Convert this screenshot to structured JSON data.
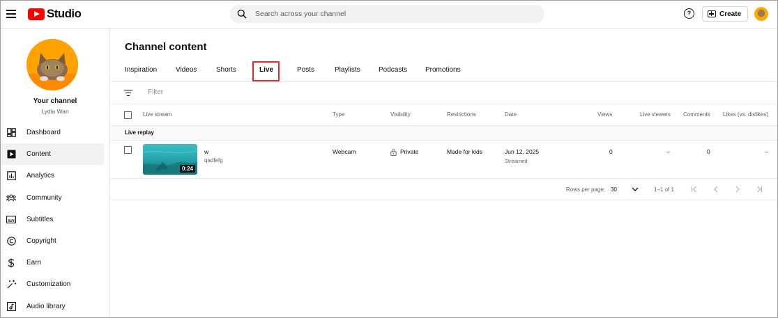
{
  "app": {
    "logo_text": "Studio"
  },
  "search": {
    "placeholder": "Search across your channel"
  },
  "header": {
    "create_label": "Create",
    "help_glyph": "?"
  },
  "sidebar": {
    "channel_name": "Your channel",
    "channel_user": "Lydia Wan",
    "items": [
      {
        "label": "Dashboard",
        "icon": "dashboard-icon"
      },
      {
        "label": "Content",
        "icon": "content-icon",
        "active": true
      },
      {
        "label": "Analytics",
        "icon": "analytics-icon"
      },
      {
        "label": "Community",
        "icon": "community-icon"
      },
      {
        "label": "Subtitles",
        "icon": "subtitles-icon"
      },
      {
        "label": "Copyright",
        "icon": "copyright-icon"
      },
      {
        "label": "Earn",
        "icon": "earn-icon"
      },
      {
        "label": "Customization",
        "icon": "customization-icon"
      },
      {
        "label": "Audio library",
        "icon": "audio-library-icon"
      }
    ]
  },
  "main": {
    "title": "Channel content",
    "tabs": [
      "Inspiration",
      "Videos",
      "Shorts",
      "Live",
      "Posts",
      "Playlists",
      "Podcasts",
      "Promotions"
    ],
    "active_tab": "Live",
    "filter_placeholder": "Filter",
    "columns": [
      "Live stream",
      "Type",
      "Visibility",
      "Restrictions",
      "Date",
      "Views",
      "Live viewers",
      "Comments",
      "Likes (vs. dislikes)"
    ],
    "group_label": "Live replay",
    "rows": [
      {
        "title": "w",
        "description": "qadfefg",
        "duration": "0:24",
        "type": "Webcam",
        "visibility": "Private",
        "restrictions": "Made for kids",
        "date": "Jun 12, 2025",
        "date_sub": "Streamed",
        "views": "0",
        "live_viewers": "–",
        "comments": "0",
        "likes": "–"
      }
    ],
    "pagination": {
      "rows_per_page_label": "Rows per page:",
      "rows_per_page": "30",
      "range": "1–1 of 1"
    }
  },
  "colors": {
    "brand": "#ff0000",
    "highlight": "#e8282b",
    "accent_bg": "#f2f2f2"
  }
}
